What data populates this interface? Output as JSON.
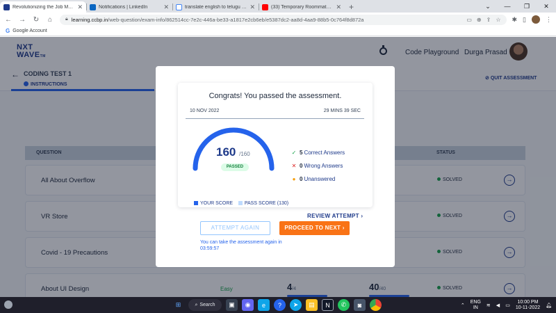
{
  "browser": {
    "tabs": [
      {
        "title": "Revolutionizing the Job Market | ",
        "favicon_color": "#1e3a8a",
        "active": true
      },
      {
        "title": "Notifications | LinkedIn",
        "favicon_color": "#0a66c2",
        "active": false
      },
      {
        "title": "translate english to telugu - Goo",
        "favicon_color": "#4285f4",
        "active": false
      },
      {
        "title": "(33) Temporary Roommates Web",
        "favicon_color": "#ff0000",
        "active": false
      }
    ],
    "url_host": "learning.ccbp.in",
    "url_path": "/web-question/exam-info/862514cc-7e2c-446a-be33-a1817e2cb6eb/e5387dc2-aa8d-4aa9-88b5-0c764f8d872a",
    "bookmark": "Google Account"
  },
  "app": {
    "logo_line1": "NXT",
    "logo_line2": "WAVE",
    "logo_tm": "TM",
    "code_playground": "Code Playground",
    "user_name": "Durga Prasad",
    "test_title": "CODING TEST 1",
    "instructions": "INSTRUCTIONS",
    "quit": "QUIT ASSESSMENT",
    "table_headers": {
      "question": "QUESTION",
      "status": "STATUS"
    },
    "rows": [
      {
        "question": "All About Overflow",
        "difficulty": "",
        "score": "",
        "score_den": "",
        "max": "",
        "max_den": "",
        "status": "SOLVED"
      },
      {
        "question": "VR Store",
        "difficulty": "",
        "score": "",
        "score_den": "",
        "max": "",
        "max_den": "",
        "status": "SOLVED"
      },
      {
        "question": "Covid - 19 Precautions",
        "difficulty": "",
        "score": "",
        "score_den": "",
        "max": "",
        "max_den": "",
        "status": "SOLVED"
      },
      {
        "question": "About UI Design",
        "difficulty": "Easy",
        "score": "4",
        "score_den": "/4",
        "max": "40",
        "max_den": "/40",
        "status": "SOLVED"
      }
    ]
  },
  "modal": {
    "heading": "Congrats! You passed the assessment.",
    "date": "10 NOV 2022",
    "duration": "29 MINS 39 SEC",
    "score": "160",
    "score_total": "/160",
    "score_fraction": 1.0,
    "badge": "PASSED",
    "stats": [
      {
        "symbol": "✓",
        "color": "#16a34a",
        "count": "5",
        "label": "Correct Answers"
      },
      {
        "symbol": "✕",
        "color": "#dc2626",
        "count": "0",
        "label": "Wrong Answers"
      },
      {
        "symbol": "●",
        "color": "#f59e0b",
        "count": "0",
        "label": "Unanswered"
      }
    ],
    "legend_your_score": "YOUR SCORE",
    "legend_pass_score": "PASS SCORE (130)",
    "review": "REVIEW ATTEMPT",
    "attempt_again": "ATTEMPT AGAIN",
    "proceed": "PROCEED TO NEXT",
    "note": "You can take the assessment again in 03:59:57"
  },
  "taskbar": {
    "search": "Search",
    "lang_line1": "ENG",
    "lang_line2": "IN",
    "time": "10:00 PM",
    "date": "10-11-2022"
  },
  "colors": {
    "brand": "#1e3a8a",
    "accent": "#2563eb",
    "gauge_fill": "#2563eb",
    "pass_track": "#bfdbfe",
    "proceed": "#f97316"
  }
}
